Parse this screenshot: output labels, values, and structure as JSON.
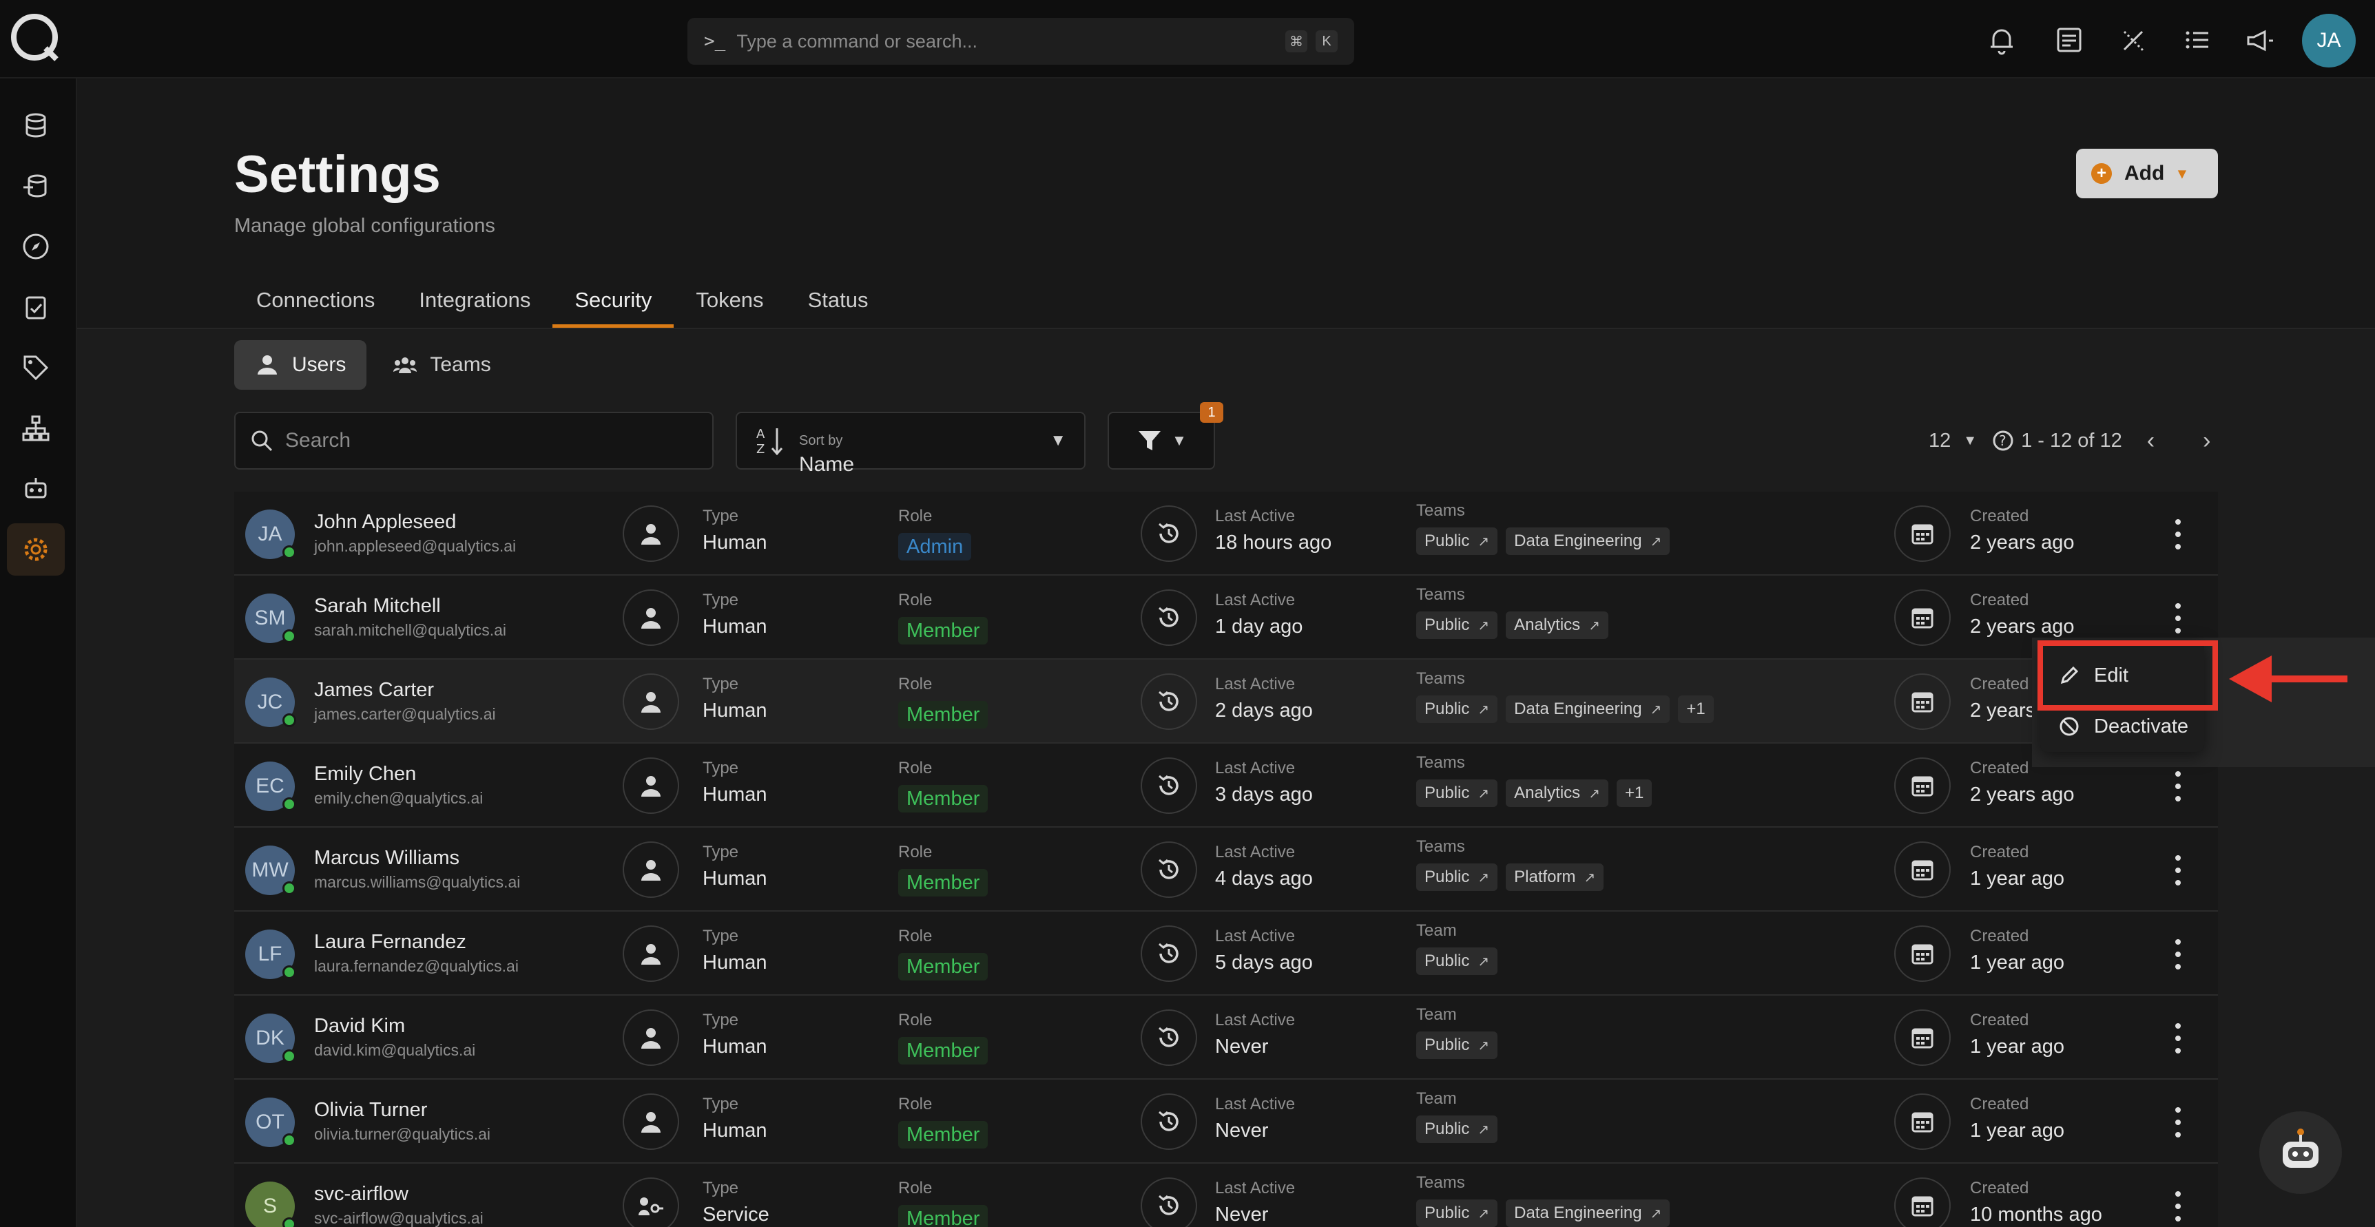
{
  "command_bar": {
    "placeholder": "Type a command or search...",
    "prompt": ">_",
    "shortcut_mod": "⌘",
    "shortcut_key": "K"
  },
  "user_avatar": "JA",
  "header": {
    "title": "Settings",
    "subtitle": "Manage global configurations",
    "add_label": "Add"
  },
  "tabs": [
    "Connections",
    "Integrations",
    "Security",
    "Tokens",
    "Status"
  ],
  "active_tab": "Security",
  "subtabs": [
    "Users",
    "Teams"
  ],
  "search": {
    "placeholder": "Search"
  },
  "sort": {
    "label": "Sort by",
    "value": "Name"
  },
  "filter": {
    "badge": "1"
  },
  "pager": {
    "page_size": "12",
    "range": "1 - 12 of 12"
  },
  "labels": {
    "type": "Type",
    "role": "Role",
    "last_active": "Last Active",
    "teams": "Teams",
    "team": "Team",
    "created": "Created"
  },
  "rows": [
    {
      "initials": "JA",
      "name": "John Appleseed",
      "email": "john.appleseed@qualytics.ai",
      "type": "Human",
      "role": "Admin",
      "last_active": "18 hours ago",
      "teams_label": "Teams",
      "teams": [
        "Public",
        "Data Engineering"
      ],
      "extra": "",
      "created": "2 years ago"
    },
    {
      "initials": "SM",
      "name": "Sarah Mitchell",
      "email": "sarah.mitchell@qualytics.ai",
      "type": "Human",
      "role": "Member",
      "last_active": "1 day ago",
      "teams_label": "Teams",
      "teams": [
        "Public",
        "Analytics"
      ],
      "extra": "",
      "created": "2 years ago"
    },
    {
      "initials": "JC",
      "name": "James Carter",
      "email": "james.carter@qualytics.ai",
      "type": "Human",
      "role": "Member",
      "last_active": "2 days ago",
      "teams_label": "Teams",
      "teams": [
        "Public",
        "Data Engineering"
      ],
      "extra": "+1",
      "created": "2 years ago"
    },
    {
      "initials": "EC",
      "name": "Emily Chen",
      "email": "emily.chen@qualytics.ai",
      "type": "Human",
      "role": "Member",
      "last_active": "3 days ago",
      "teams_label": "Teams",
      "teams": [
        "Public",
        "Analytics"
      ],
      "extra": "+1",
      "created": "2 years ago"
    },
    {
      "initials": "MW",
      "name": "Marcus Williams",
      "email": "marcus.williams@qualytics.ai",
      "type": "Human",
      "role": "Member",
      "last_active": "4 days ago",
      "teams_label": "Teams",
      "teams": [
        "Public",
        "Platform"
      ],
      "extra": "",
      "created": "1 year ago"
    },
    {
      "initials": "LF",
      "name": "Laura Fernandez",
      "email": "laura.fernandez@qualytics.ai",
      "type": "Human",
      "role": "Member",
      "last_active": "5 days ago",
      "teams_label": "Team",
      "teams": [
        "Public"
      ],
      "extra": "",
      "created": "1 year ago"
    },
    {
      "initials": "DK",
      "name": "David Kim",
      "email": "david.kim@qualytics.ai",
      "type": "Human",
      "role": "Member",
      "last_active": "Never",
      "teams_label": "Team",
      "teams": [
        "Public"
      ],
      "extra": "",
      "created": "1 year ago"
    },
    {
      "initials": "OT",
      "name": "Olivia Turner",
      "email": "olivia.turner@qualytics.ai",
      "type": "Human",
      "role": "Member",
      "last_active": "Never",
      "teams_label": "Team",
      "teams": [
        "Public"
      ],
      "extra": "",
      "created": "1 year ago"
    },
    {
      "initials": "S",
      "name": "svc-airflow",
      "email": "svc-airflow@qualytics.ai",
      "type": "Service",
      "role": "Member",
      "last_active": "Never",
      "teams_label": "Teams",
      "teams": [
        "Public",
        "Data Engineering"
      ],
      "extra": "",
      "created": "10 months ago"
    }
  ],
  "dropdown": {
    "edit": "Edit",
    "deactivate": "Deactivate"
  },
  "colors": {
    "accent": "#d97b16",
    "annotation": "#e8372c",
    "member": "#3ec15a",
    "admin": "#3a88c9"
  }
}
